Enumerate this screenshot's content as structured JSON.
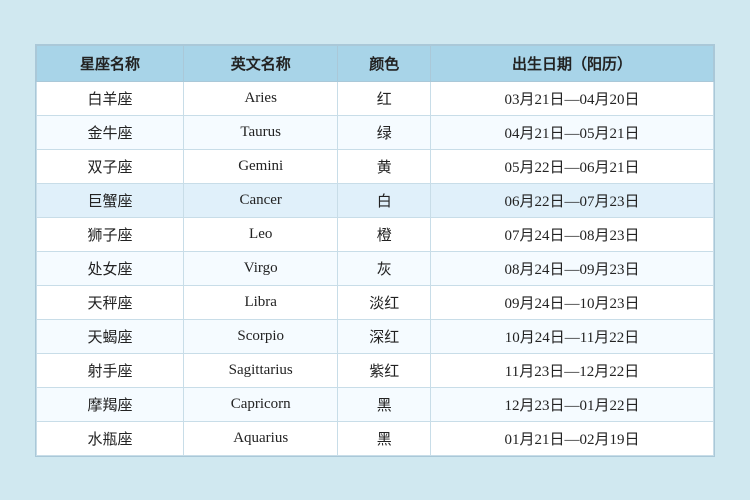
{
  "table": {
    "headers": [
      "星座名称",
      "英文名称",
      "颜色",
      "出生日期（阳历）"
    ],
    "rows": [
      {
        "chinese": "白羊座",
        "english": "Aries",
        "color": "红",
        "dates": "03月21日—04月20日",
        "highlight": false
      },
      {
        "chinese": "金牛座",
        "english": "Taurus",
        "color": "绿",
        "dates": "04月21日—05月21日",
        "highlight": false
      },
      {
        "chinese": "双子座",
        "english": "Gemini",
        "color": "黄",
        "dates": "05月22日—06月21日",
        "highlight": false
      },
      {
        "chinese": "巨蟹座",
        "english": "Cancer",
        "color": "白",
        "dates": "06月22日—07月23日",
        "highlight": true
      },
      {
        "chinese": "狮子座",
        "english": "Leo",
        "color": "橙",
        "dates": "07月24日—08月23日",
        "highlight": false
      },
      {
        "chinese": "处女座",
        "english": "Virgo",
        "color": "灰",
        "dates": "08月24日—09月23日",
        "highlight": false
      },
      {
        "chinese": "天秤座",
        "english": "Libra",
        "color": "淡红",
        "dates": "09月24日—10月23日",
        "highlight": false
      },
      {
        "chinese": "天蝎座",
        "english": "Scorpio",
        "color": "深红",
        "dates": "10月24日—11月22日",
        "highlight": false
      },
      {
        "chinese": "射手座",
        "english": "Sagittarius",
        "color": "紫红",
        "dates": "11月23日—12月22日",
        "highlight": false
      },
      {
        "chinese": "摩羯座",
        "english": "Capricorn",
        "color": "黑",
        "dates": "12月23日—01月22日",
        "highlight": false
      },
      {
        "chinese": "水瓶座",
        "english": "Aquarius",
        "color": "黑",
        "dates": "01月21日—02月19日",
        "highlight": false
      }
    ]
  }
}
